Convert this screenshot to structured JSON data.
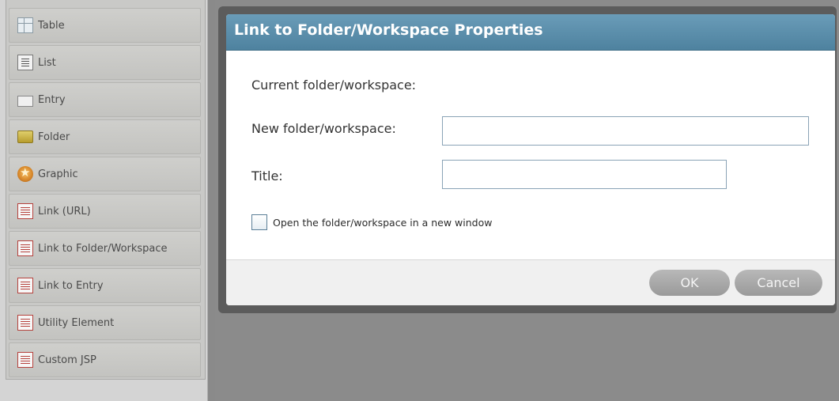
{
  "palette": {
    "items": [
      {
        "label": "Table",
        "icon": "table-icon"
      },
      {
        "label": "List",
        "icon": "list-icon"
      },
      {
        "label": "Entry",
        "icon": "entry-icon"
      },
      {
        "label": "Folder",
        "icon": "folder-icon"
      },
      {
        "label": "Graphic",
        "icon": "graphic-icon"
      },
      {
        "label": "Link (URL)",
        "icon": "form-icon"
      },
      {
        "label": "Link to Folder/Workspace",
        "icon": "form-icon"
      },
      {
        "label": "Link to Entry",
        "icon": "form-icon"
      },
      {
        "label": "Utility Element",
        "icon": "form-icon"
      },
      {
        "label": "Custom JSP",
        "icon": "form-icon"
      }
    ]
  },
  "dialog": {
    "title": "Link to Folder/Workspace Properties",
    "current_label": "Current folder/workspace:",
    "new_label": "New folder/workspace:",
    "new_value": "",
    "title_label": "Title:",
    "title_value": "",
    "checkbox_label": "Open the folder/workspace in a new window",
    "checkbox_checked": false,
    "ok_label": "OK",
    "cancel_label": "Cancel"
  },
  "colors": {
    "header": "#5a8fac",
    "button": "#a8a8a8",
    "overlay": "#8b8b8b"
  }
}
